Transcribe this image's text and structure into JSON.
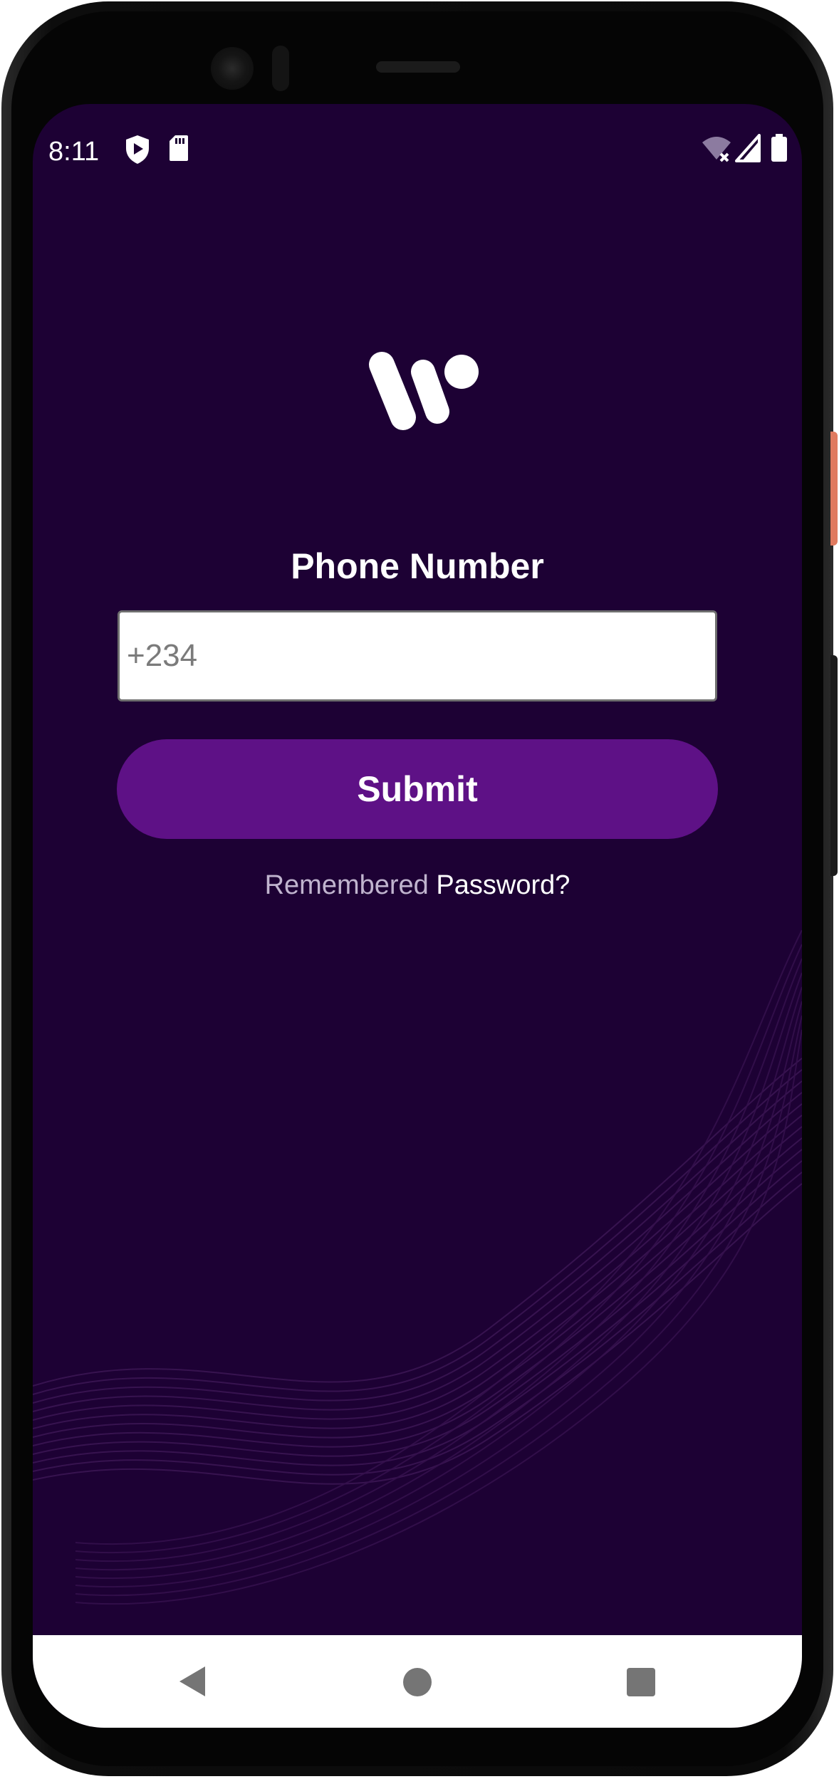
{
  "status_bar": {
    "time": "8:11",
    "left_icons": [
      "shield-play-icon",
      "sd-card-icon"
    ],
    "right_icons": [
      "wifi-off-icon",
      "cell-signal-icon",
      "battery-icon"
    ]
  },
  "brand": {
    "logo": "w-logo"
  },
  "form": {
    "label": "Phone Number",
    "phone_placeholder": "+234",
    "phone_value": "",
    "submit_label": "Submit"
  },
  "footer_link": {
    "prefix": "Remembered",
    "action": "Password?"
  },
  "nav_bar": {
    "buttons": [
      "back-icon",
      "home-icon",
      "recents-icon"
    ]
  },
  "colors": {
    "background": "#1d0134",
    "button": "#5e1186",
    "text": "#ffffff",
    "muted_text": "#c0b4ce"
  }
}
